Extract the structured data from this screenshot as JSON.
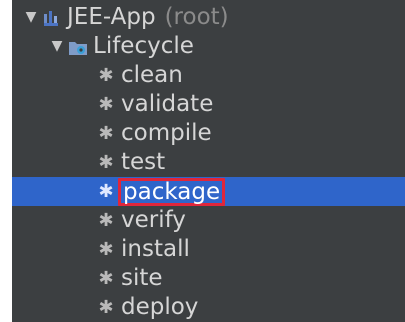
{
  "tree": {
    "root": {
      "name": "JEE-App",
      "suffix": "(root)",
      "icon": "maven-project-icon",
      "expanded_arrow": "▼"
    },
    "lifecycle": {
      "name": "Lifecycle",
      "icon": "lifecycle-folder-icon",
      "expanded_arrow": "▼"
    },
    "goals": [
      {
        "label": "clean"
      },
      {
        "label": "validate"
      },
      {
        "label": "compile"
      },
      {
        "label": "test"
      },
      {
        "label": "package",
        "selected": true
      },
      {
        "label": "verify"
      },
      {
        "label": "install"
      },
      {
        "label": "site"
      },
      {
        "label": "deploy"
      }
    ],
    "goal_icon": "gear-icon",
    "colors": {
      "panel_bg": "#3c3f41",
      "selection_bg": "#2f65ca",
      "highlight_border": "#e0263b",
      "text": "#d6d6d6",
      "muted_text": "#8b8b8b"
    }
  }
}
